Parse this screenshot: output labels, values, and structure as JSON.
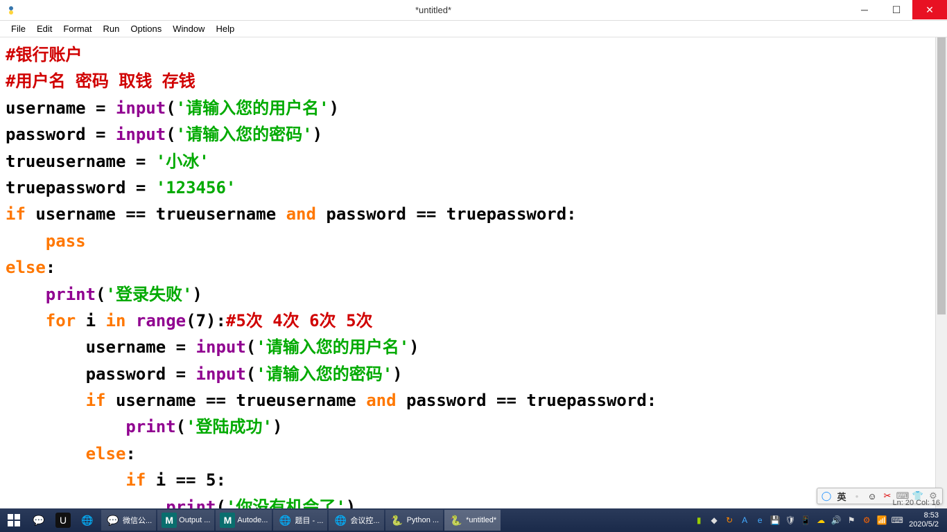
{
  "window": {
    "title": "*untitled*"
  },
  "menu": {
    "file": "File",
    "edit": "Edit",
    "format": "Format",
    "run": "Run",
    "options": "Options",
    "window": "Window",
    "help": "Help"
  },
  "code": {
    "c1": "#银行账户",
    "c2": "#用户名 密码 取钱 存钱",
    "l3_a": "username = ",
    "l3_b": "input",
    "l3_c": "(",
    "l3_d": "'请输入您的用户名'",
    "l3_e": ")",
    "l4_a": "password = ",
    "l4_b": "input",
    "l4_c": "(",
    "l4_d": "'请输入您的密码'",
    "l4_e": ")",
    "l5_a": "trueusername = ",
    "l5_b": "'小冰'",
    "l6_a": "truepassword = ",
    "l6_b": "'123456'",
    "l7_a": "if",
    "l7_b": " username == trueusername ",
    "l7_c": "and",
    "l7_d": " password == truepassword:",
    "l8_a": "    ",
    "l8_b": "pass",
    "l9_a": "else",
    "l9_b": ":",
    "l10_a": "    ",
    "l10_b": "print",
    "l10_c": "(",
    "l10_d": "'登录失败'",
    "l10_e": ")",
    "l11_a": "    ",
    "l11_b": "for",
    "l11_c": " i ",
    "l11_d": "in",
    "l11_e": " ",
    "l11_f": "range",
    "l11_g": "(7):",
    "l11_h": "#5次 4次 6次 5次",
    "l12_a": "        username = ",
    "l12_b": "input",
    "l12_c": "(",
    "l12_d": "'请输入您的用户名'",
    "l12_e": ")",
    "l13_a": "        password = ",
    "l13_b": "input",
    "l13_c": "(",
    "l13_d": "'请输入您的密码'",
    "l13_e": ")",
    "l14_a": "        ",
    "l14_b": "if",
    "l14_c": " username == trueusername ",
    "l14_d": "and",
    "l14_e": " password == truepassword:",
    "l15_a": "            ",
    "l15_b": "print",
    "l15_c": "(",
    "l15_d": "'登陆成功'",
    "l15_e": ")",
    "l16_a": "        ",
    "l16_b": "else",
    "l16_c": ":",
    "l17_a": "            ",
    "l17_b": "if",
    "l17_c": " i == 5:",
    "l18_a": "                ",
    "l18_b": "print",
    "l18_c": "(",
    "l18_d": "'你没有机会了'",
    "l18_e": ")"
  },
  "taskbar": {
    "items": [
      {
        "label": "微信公...",
        "icon": "💬"
      },
      {
        "label": "Output ...",
        "icon": "M"
      },
      {
        "label": "Autode...",
        "icon": "M"
      },
      {
        "label": "题目 - ...",
        "icon": "🌐"
      },
      {
        "label": "会议控...",
        "icon": "🌐"
      },
      {
        "label": "Python ...",
        "icon": "🐍"
      },
      {
        "label": "*untitled*",
        "icon": "🐍"
      }
    ]
  },
  "ime": {
    "lang": "英"
  },
  "clock": {
    "time": "8:53",
    "date": "2020/5/2"
  },
  "status": {
    "pos": "Ln: 20  Col: 16"
  }
}
